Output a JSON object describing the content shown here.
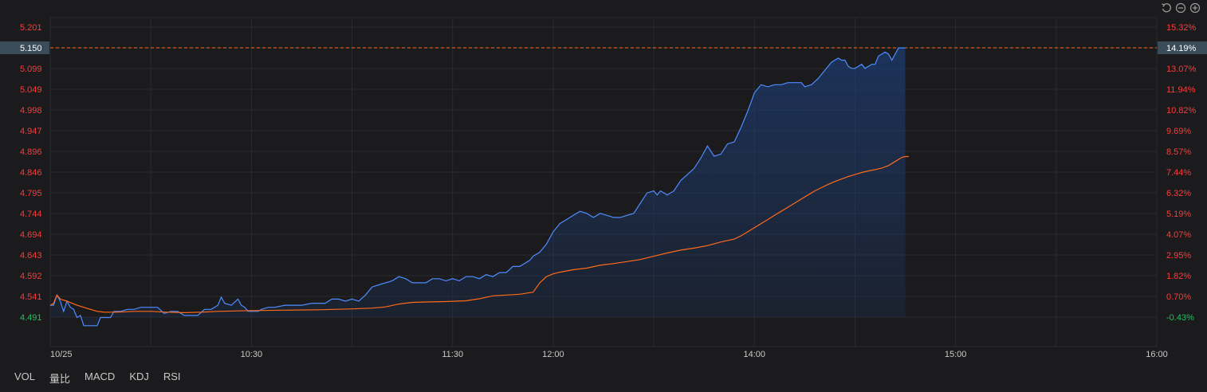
{
  "chart_data": {
    "type": "line",
    "date_label": "10/25",
    "x_tick_labels": [
      "10:30",
      "11:30",
      "12:00",
      "14:00",
      "15:00",
      "16:00"
    ],
    "y_left_ticks": [
      "5.201",
      "5.150",
      "5.099",
      "5.049",
      "4.998",
      "4.947",
      "4.896",
      "4.846",
      "4.795",
      "4.744",
      "4.694",
      "4.643",
      "4.592",
      "4.541",
      "4.491"
    ],
    "y_right_ticks": [
      "15.32%",
      "14.19%",
      "13.07%",
      "11.94%",
      "10.82%",
      "9.69%",
      "8.57%",
      "7.44%",
      "6.32%",
      "5.19%",
      "4.07%",
      "2.95%",
      "1.82%",
      "0.70%",
      "-0.43%"
    ],
    "highlight": {
      "price": "5.150",
      "percent": "14.19%"
    },
    "ylim": [
      4.491,
      5.201
    ],
    "session_minutes": 330,
    "series": [
      {
        "key": "price",
        "color": "#4e8cff",
        "points": [
          [
            0,
            4.52
          ],
          [
            1,
            4.52
          ],
          [
            2,
            4.545
          ],
          [
            3,
            4.53
          ],
          [
            4,
            4.505
          ],
          [
            5,
            4.53
          ],
          [
            6,
            4.515
          ],
          [
            7,
            4.51
          ],
          [
            8,
            4.49
          ],
          [
            9,
            4.495
          ],
          [
            10,
            4.47
          ],
          [
            12,
            4.47
          ],
          [
            14,
            4.47
          ],
          [
            15,
            4.49
          ],
          [
            17,
            4.49
          ],
          [
            18,
            4.49
          ],
          [
            19,
            4.505
          ],
          [
            21,
            4.505
          ],
          [
            23,
            4.51
          ],
          [
            25,
            4.51
          ],
          [
            27,
            4.515
          ],
          [
            30,
            4.515
          ],
          [
            32,
            4.515
          ],
          [
            34,
            4.5
          ],
          [
            36,
            4.505
          ],
          [
            38,
            4.505
          ],
          [
            40,
            4.495
          ],
          [
            42,
            4.495
          ],
          [
            44,
            4.495
          ],
          [
            46,
            4.51
          ],
          [
            48,
            4.51
          ],
          [
            50,
            4.52
          ],
          [
            51,
            4.54
          ],
          [
            52,
            4.525
          ],
          [
            54,
            4.52
          ],
          [
            56,
            4.535
          ],
          [
            57,
            4.52
          ],
          [
            58,
            4.515
          ],
          [
            59,
            4.505
          ],
          [
            61,
            4.505
          ],
          [
            62,
            4.505
          ],
          [
            63,
            4.51
          ],
          [
            65,
            4.515
          ],
          [
            67,
            4.515
          ],
          [
            70,
            4.52
          ],
          [
            75,
            4.52
          ],
          [
            78,
            4.525
          ],
          [
            80,
            4.525
          ],
          [
            82,
            4.525
          ],
          [
            84,
            4.535
          ],
          [
            86,
            4.535
          ],
          [
            88,
            4.53
          ],
          [
            90,
            4.535
          ],
          [
            92,
            4.53
          ],
          [
            94,
            4.545
          ],
          [
            96,
            4.565
          ],
          [
            98,
            4.57
          ],
          [
            100,
            4.575
          ],
          [
            102,
            4.58
          ],
          [
            104,
            4.59
          ],
          [
            106,
            4.585
          ],
          [
            108,
            4.575
          ],
          [
            110,
            4.575
          ],
          [
            112,
            4.575
          ],
          [
            114,
            4.585
          ],
          [
            116,
            4.585
          ],
          [
            118,
            4.58
          ],
          [
            120,
            4.585
          ],
          [
            122,
            4.58
          ],
          [
            124,
            4.59
          ],
          [
            126,
            4.59
          ],
          [
            128,
            4.585
          ],
          [
            130,
            4.595
          ],
          [
            132,
            4.59
          ],
          [
            134,
            4.6
          ],
          [
            136,
            4.6
          ],
          [
            138,
            4.615
          ],
          [
            140,
            4.615
          ],
          [
            142,
            4.625
          ],
          [
            143,
            4.63
          ],
          [
            144,
            4.64
          ],
          [
            146,
            4.65
          ],
          [
            148,
            4.67
          ],
          [
            150,
            4.7
          ],
          [
            152,
            4.72
          ],
          [
            154,
            4.73
          ],
          [
            156,
            4.74
          ],
          [
            158,
            4.75
          ],
          [
            160,
            4.745
          ],
          [
            162,
            4.735
          ],
          [
            164,
            4.745
          ],
          [
            166,
            4.74
          ],
          [
            168,
            4.735
          ],
          [
            170,
            4.735
          ],
          [
            172,
            4.74
          ],
          [
            174,
            4.745
          ],
          [
            176,
            4.77
          ],
          [
            178,
            4.795
          ],
          [
            180,
            4.8
          ],
          [
            181,
            4.79
          ],
          [
            182,
            4.8
          ],
          [
            184,
            4.79
          ],
          [
            186,
            4.8
          ],
          [
            188,
            4.825
          ],
          [
            190,
            4.84
          ],
          [
            192,
            4.855
          ],
          [
            194,
            4.88
          ],
          [
            196,
            4.91
          ],
          [
            198,
            4.885
          ],
          [
            200,
            4.89
          ],
          [
            202,
            4.915
          ],
          [
            204,
            4.92
          ],
          [
            206,
            4.955
          ],
          [
            208,
            4.995
          ],
          [
            210,
            5.04
          ],
          [
            212,
            5.06
          ],
          [
            214,
            5.055
          ],
          [
            216,
            5.06
          ],
          [
            218,
            5.06
          ],
          [
            220,
            5.065
          ],
          [
            222,
            5.065
          ],
          [
            224,
            5.065
          ],
          [
            225,
            5.055
          ],
          [
            227,
            5.06
          ],
          [
            229,
            5.075
          ],
          [
            231,
            5.095
          ],
          [
            233,
            5.115
          ],
          [
            235,
            5.125
          ],
          [
            236,
            5.12
          ],
          [
            237,
            5.12
          ],
          [
            238,
            5.105
          ],
          [
            239,
            5.1
          ],
          [
            240,
            5.1
          ],
          [
            241,
            5.105
          ],
          [
            242,
            5.11
          ],
          [
            243,
            5.1
          ],
          [
            244,
            5.105
          ],
          [
            245,
            5.11
          ],
          [
            246,
            5.11
          ],
          [
            247,
            5.13
          ],
          [
            249,
            5.14
          ],
          [
            250,
            5.135
          ],
          [
            251,
            5.12
          ],
          [
            252,
            5.135
          ],
          [
            253,
            5.15
          ],
          [
            254,
            5.15
          ],
          [
            255,
            5.15
          ]
        ]
      },
      {
        "key": "average",
        "color": "#ff6a1a",
        "points": [
          [
            0,
            4.52
          ],
          [
            1,
            4.525
          ],
          [
            2,
            4.545
          ],
          [
            3,
            4.535
          ],
          [
            5,
            4.53
          ],
          [
            8,
            4.52
          ],
          [
            10,
            4.515
          ],
          [
            12,
            4.51
          ],
          [
            14,
            4.505
          ],
          [
            16,
            4.503
          ],
          [
            20,
            4.503
          ],
          [
            25,
            4.505
          ],
          [
            30,
            4.505
          ],
          [
            35,
            4.503
          ],
          [
            40,
            4.502
          ],
          [
            45,
            4.503
          ],
          [
            50,
            4.505
          ],
          [
            55,
            4.506
          ],
          [
            60,
            4.507
          ],
          [
            70,
            4.508
          ],
          [
            80,
            4.509
          ],
          [
            90,
            4.511
          ],
          [
            96,
            4.513
          ],
          [
            100,
            4.516
          ],
          [
            104,
            4.523
          ],
          [
            108,
            4.527
          ],
          [
            112,
            4.528
          ],
          [
            118,
            4.529
          ],
          [
            124,
            4.531
          ],
          [
            128,
            4.536
          ],
          [
            132,
            4.543
          ],
          [
            136,
            4.545
          ],
          [
            140,
            4.547
          ],
          [
            144,
            4.552
          ],
          [
            146,
            4.575
          ],
          [
            148,
            4.59
          ],
          [
            150,
            4.597
          ],
          [
            152,
            4.601
          ],
          [
            156,
            4.607
          ],
          [
            160,
            4.611
          ],
          [
            164,
            4.618
          ],
          [
            168,
            4.622
          ],
          [
            172,
            4.627
          ],
          [
            176,
            4.632
          ],
          [
            180,
            4.64
          ],
          [
            184,
            4.648
          ],
          [
            188,
            4.655
          ],
          [
            192,
            4.66
          ],
          [
            196,
            4.666
          ],
          [
            200,
            4.675
          ],
          [
            204,
            4.682
          ],
          [
            206,
            4.69
          ],
          [
            208,
            4.7
          ],
          [
            210,
            4.71
          ],
          [
            212,
            4.72
          ],
          [
            214,
            4.73
          ],
          [
            216,
            4.74
          ],
          [
            218,
            4.75
          ],
          [
            220,
            4.76
          ],
          [
            222,
            4.77
          ],
          [
            224,
            4.78
          ],
          [
            226,
            4.79
          ],
          [
            228,
            4.8
          ],
          [
            230,
            4.808
          ],
          [
            232,
            4.816
          ],
          [
            234,
            4.823
          ],
          [
            236,
            4.829
          ],
          [
            238,
            4.835
          ],
          [
            240,
            4.84
          ],
          [
            242,
            4.845
          ],
          [
            244,
            4.849
          ],
          [
            246,
            4.852
          ],
          [
            248,
            4.856
          ],
          [
            250,
            4.862
          ],
          [
            252,
            4.872
          ],
          [
            254,
            4.882
          ],
          [
            255,
            4.884
          ],
          [
            256,
            4.884
          ]
        ]
      }
    ]
  },
  "indicator_tabs": [
    "VOL",
    "量比",
    "MACD",
    "KDJ",
    "RSI"
  ],
  "tools": [
    "reset-icon",
    "zoom-out-icon",
    "zoom-in-icon"
  ],
  "colors": {
    "up": "#ff3a3a",
    "down": "#20c060",
    "grid": "#2a2b2e",
    "bg": "#1b1b1d",
    "axis_text": "#c9c9c9",
    "highlight_bg": "#3a4b5a"
  }
}
